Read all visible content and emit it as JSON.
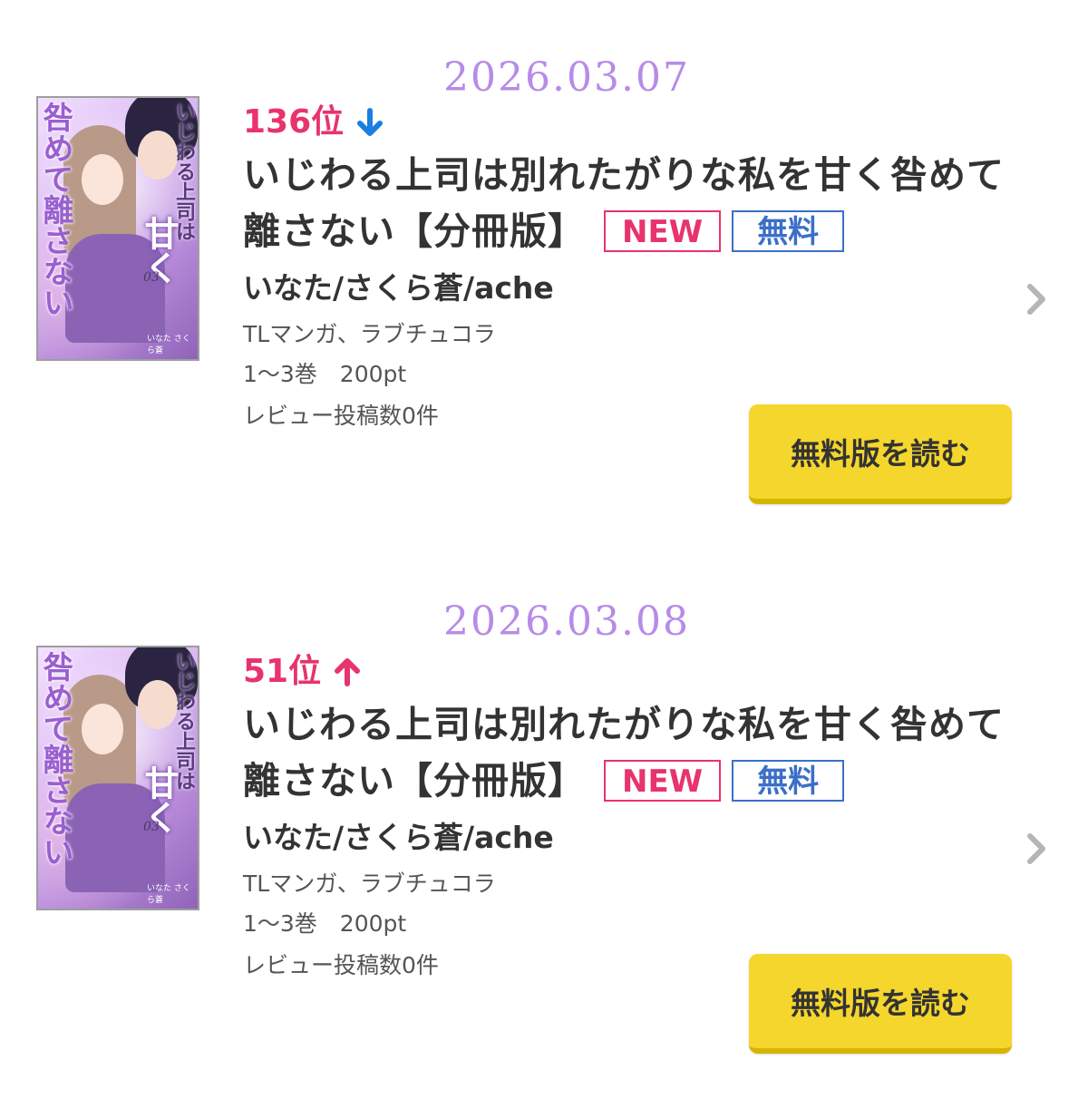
{
  "entries": [
    {
      "date": "2026.03.07",
      "rank": "136位",
      "rank_trend": "down",
      "title": "いじわる上司は別れたがりな私を甘く咎めて離さない【分冊版】",
      "badge_new": "NEW",
      "badge_free": "無料",
      "author": "いなた/さくら蒼/ache",
      "genre": "TLマンガ、ラブチュコラ",
      "volumes_price": "1～3巻　200pt",
      "reviews": "レビュー投稿数0件",
      "read_button": "無料版を読む",
      "cover": {
        "title_left": "咎めて離さない",
        "title_right_top": "いじわる上司は",
        "title_right_big": "甘く",
        "volume": "03",
        "author_mark": "いなた さくら蒼"
      }
    },
    {
      "date": "2026.03.08",
      "rank": "51位",
      "rank_trend": "up",
      "title": "いじわる上司は別れたがりな私を甘く咎めて離さない【分冊版】",
      "badge_new": "NEW",
      "badge_free": "無料",
      "author": "いなた/さくら蒼/ache",
      "genre": "TLマンガ、ラブチュコラ",
      "volumes_price": "1～3巻　200pt",
      "reviews": "レビュー投稿数0件",
      "read_button": "無料版を読む",
      "cover": {
        "title_left": "咎めて離さない",
        "title_right_top": "いじわる上司は",
        "title_right_big": "甘く",
        "volume": "03",
        "author_mark": "いなた さくら蒼"
      }
    }
  ],
  "colors": {
    "date": "#b78be8",
    "rank": "#e8336c",
    "arrow_down": "#1a7fe0",
    "arrow_up": "#e8336c",
    "badge_new": "#e8336c",
    "badge_free": "#3b6fc8",
    "button": "#f5d62c"
  },
  "icons": {
    "down": "arrow-down-icon",
    "up": "arrow-up-icon",
    "chevron": "chevron-right-icon"
  }
}
